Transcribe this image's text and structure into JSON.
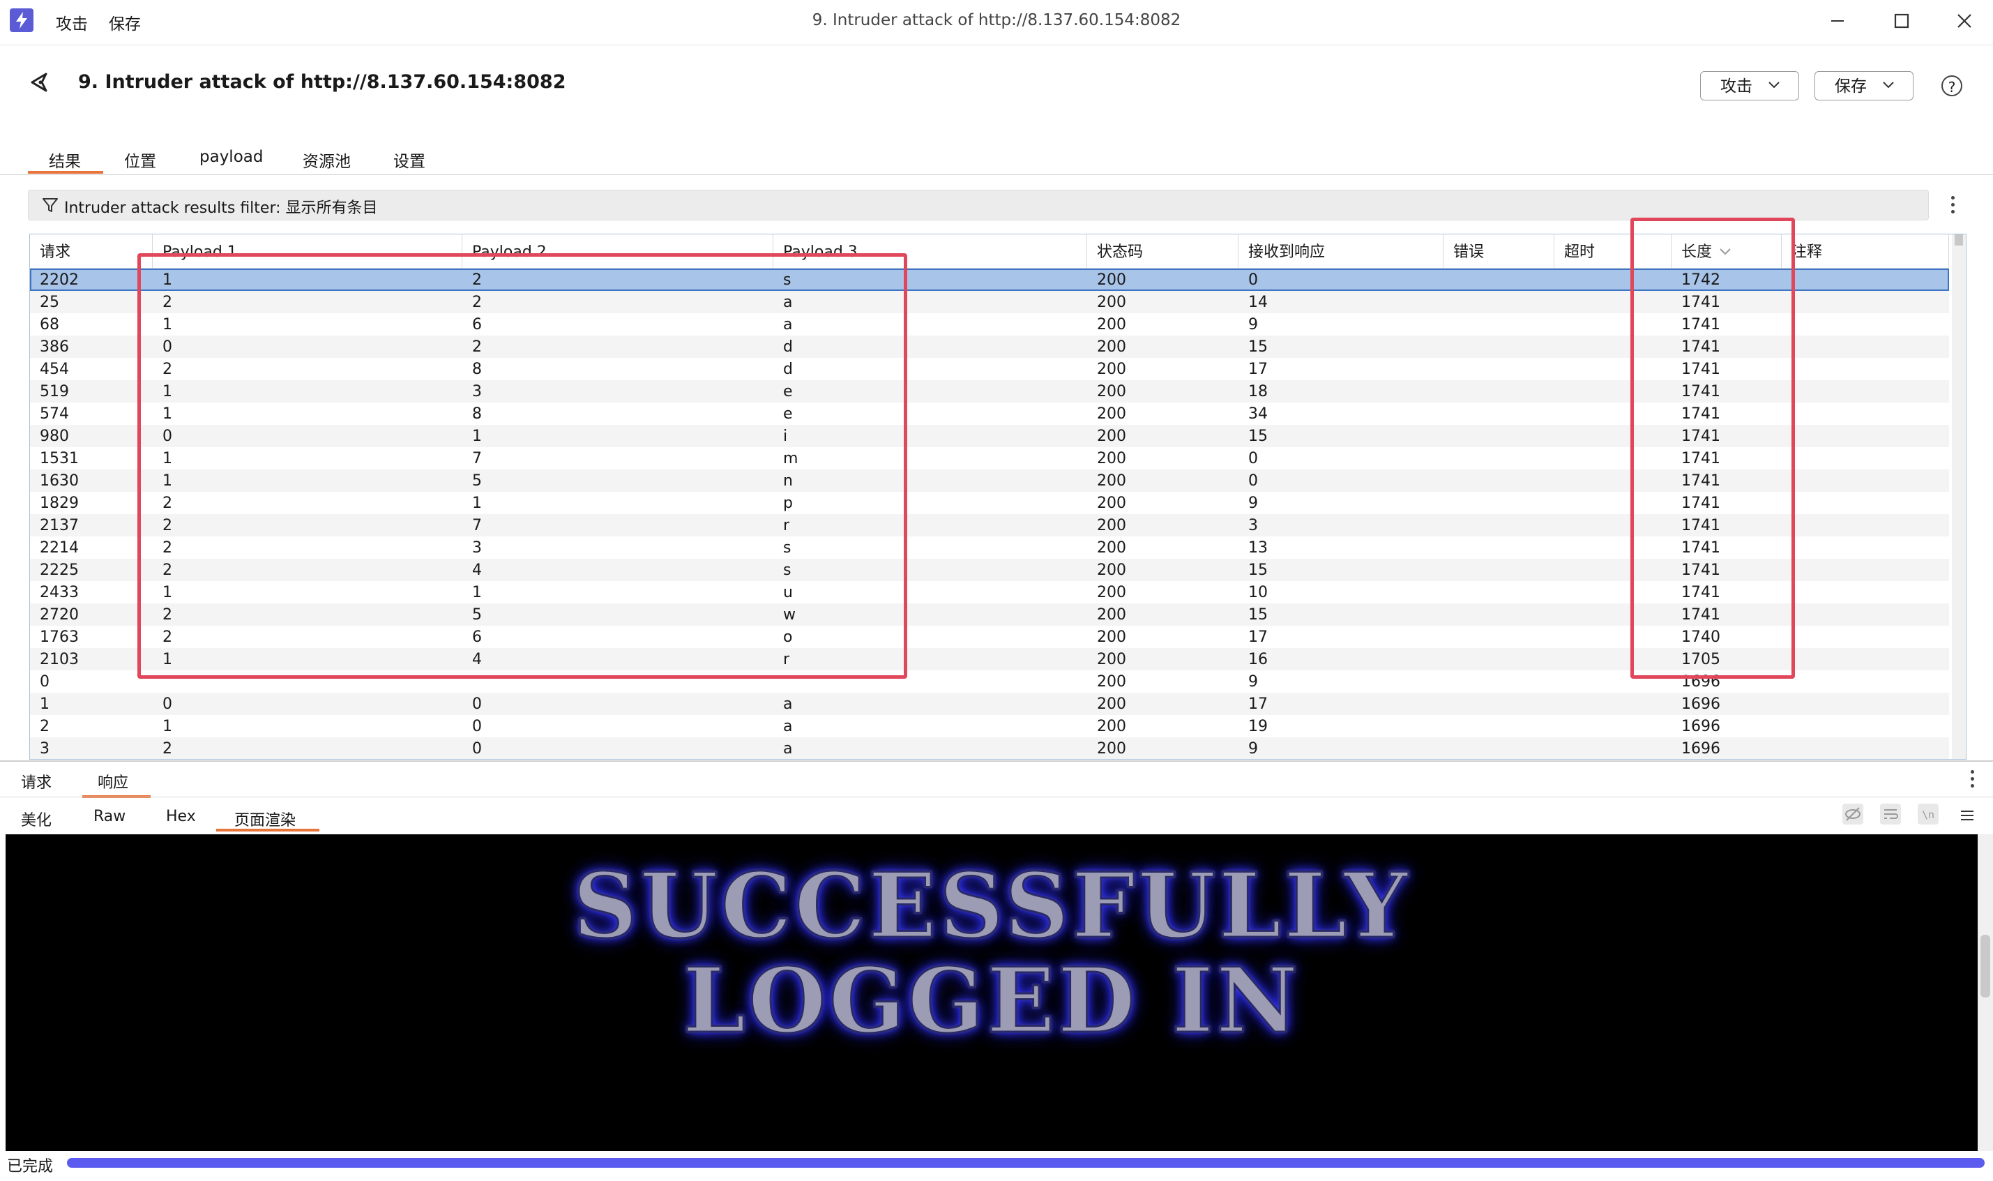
{
  "titlebar": {
    "menu": [
      "攻击",
      "保存"
    ],
    "window_title": "9. Intruder attack of http://8.137.60.154:8082"
  },
  "header": {
    "title": "9. Intruder attack of http://8.137.60.154:8082",
    "attack_button": "攻击",
    "save_button": "保存",
    "help_label": "?"
  },
  "tabs": {
    "results": "结果",
    "positions": "位置",
    "payloads": "payload",
    "resource_pool": "资源池",
    "settings": "设置",
    "active": "结果"
  },
  "filter": {
    "label": "Intruder attack results filter: 显示所有条目"
  },
  "table": {
    "columns": [
      "请求",
      "Payload 1",
      "Payload 2",
      "Payload 3",
      "状态码",
      "接收到响应",
      "错误",
      "超时",
      "长度",
      "注释"
    ],
    "sort_column": "长度",
    "rows": [
      [
        "2202",
        "1",
        "2",
        "s",
        "200",
        "0",
        "",
        "",
        "1742",
        ""
      ],
      [
        "25",
        "2",
        "2",
        "a",
        "200",
        "14",
        "",
        "",
        "1741",
        ""
      ],
      [
        "68",
        "1",
        "6",
        "a",
        "200",
        "9",
        "",
        "",
        "1741",
        ""
      ],
      [
        "386",
        "0",
        "2",
        "d",
        "200",
        "15",
        "",
        "",
        "1741",
        ""
      ],
      [
        "454",
        "2",
        "8",
        "d",
        "200",
        "17",
        "",
        "",
        "1741",
        ""
      ],
      [
        "519",
        "1",
        "3",
        "e",
        "200",
        "18",
        "",
        "",
        "1741",
        ""
      ],
      [
        "574",
        "1",
        "8",
        "e",
        "200",
        "34",
        "",
        "",
        "1741",
        ""
      ],
      [
        "980",
        "0",
        "1",
        "i",
        "200",
        "15",
        "",
        "",
        "1741",
        ""
      ],
      [
        "1531",
        "1",
        "7",
        "m",
        "200",
        "0",
        "",
        "",
        "1741",
        ""
      ],
      [
        "1630",
        "1",
        "5",
        "n",
        "200",
        "0",
        "",
        "",
        "1741",
        ""
      ],
      [
        "1829",
        "2",
        "1",
        "p",
        "200",
        "9",
        "",
        "",
        "1741",
        ""
      ],
      [
        "2137",
        "2",
        "7",
        "r",
        "200",
        "3",
        "",
        "",
        "1741",
        ""
      ],
      [
        "2214",
        "2",
        "3",
        "s",
        "200",
        "13",
        "",
        "",
        "1741",
        ""
      ],
      [
        "2225",
        "2",
        "4",
        "s",
        "200",
        "15",
        "",
        "",
        "1741",
        ""
      ],
      [
        "2433",
        "1",
        "1",
        "u",
        "200",
        "10",
        "",
        "",
        "1741",
        ""
      ],
      [
        "2720",
        "2",
        "5",
        "w",
        "200",
        "15",
        "",
        "",
        "1741",
        ""
      ],
      [
        "1763",
        "2",
        "6",
        "o",
        "200",
        "17",
        "",
        "",
        "1740",
        ""
      ],
      [
        "2103",
        "1",
        "4",
        "r",
        "200",
        "16",
        "",
        "",
        "1705",
        ""
      ],
      [
        "0",
        "",
        "",
        "",
        "200",
        "9",
        "",
        "",
        "1696",
        ""
      ],
      [
        "1",
        "0",
        "0",
        "a",
        "200",
        "17",
        "",
        "",
        "1696",
        ""
      ],
      [
        "2",
        "1",
        "0",
        "a",
        "200",
        "19",
        "",
        "",
        "1696",
        ""
      ],
      [
        "3",
        "2",
        "0",
        "a",
        "200",
        "9",
        "",
        "",
        "1696",
        ""
      ]
    ]
  },
  "bottom_panel": {
    "tabs": [
      "请求",
      "响应"
    ],
    "active_tab": "响应",
    "view_tabs": [
      "美化",
      "Raw",
      "Hex",
      "页面渲染"
    ],
    "active_view": "页面渲染",
    "render_text_line1": "SUCCESSFULLY",
    "render_text_line2": "LOGGED IN"
  },
  "status": {
    "text": "已完成",
    "progress": 1.0
  },
  "colors": {
    "accent": "#e8743b",
    "highlight_box": "#e0475b",
    "selected_row": "#a8c4e8",
    "progress": "#5b5bf0"
  }
}
